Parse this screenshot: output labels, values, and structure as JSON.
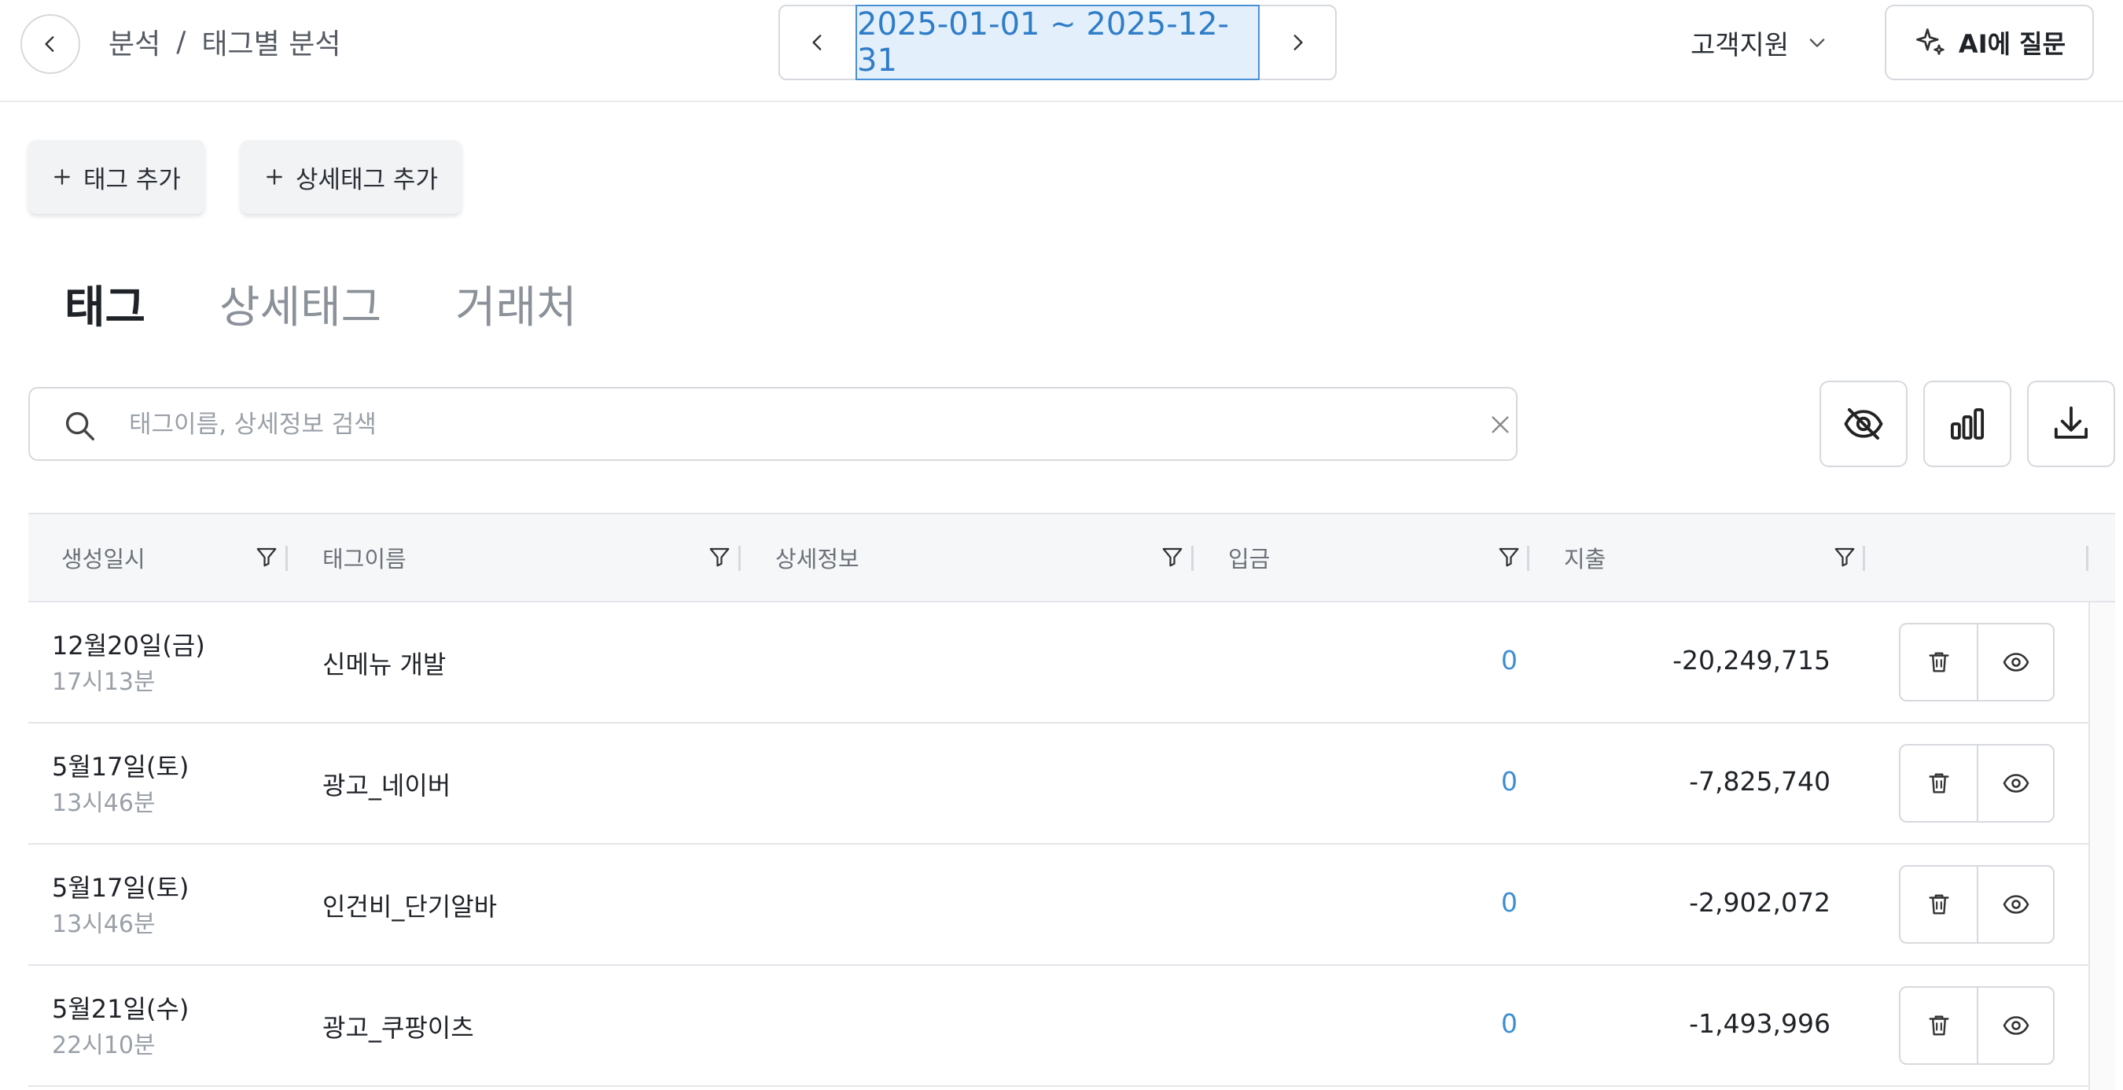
{
  "breadcrumb": {
    "parent": "분석",
    "separator": "/",
    "current": "태그별 분석"
  },
  "date_range": "2025-01-01 ~ 2025-12-31",
  "header": {
    "support_label": "고객지원",
    "ai_label": "AI에 질문"
  },
  "actions": {
    "add_tag": "태그 추가",
    "add_detail_tag": "상세태그 추가"
  },
  "tabs": [
    {
      "label": "태그",
      "active": true
    },
    {
      "label": "상세태그",
      "active": false
    },
    {
      "label": "거래처",
      "active": false
    }
  ],
  "search": {
    "placeholder": "태그이름, 상세정보 검색",
    "value": ""
  },
  "table": {
    "columns": [
      "생성일시",
      "태그이름",
      "상세정보",
      "입금",
      "지출"
    ],
    "rows": [
      {
        "date": "12월20일(금)",
        "time": "17시13분",
        "tag": "신메뉴 개발",
        "detail": "",
        "deposit": "0",
        "expense": "-20,249,715"
      },
      {
        "date": "5월17일(토)",
        "time": "13시46분",
        "tag": "광고_네이버",
        "detail": "",
        "deposit": "0",
        "expense": "-7,825,740"
      },
      {
        "date": "5월17일(토)",
        "time": "13시46분",
        "tag": "인건비_단기알바",
        "detail": "",
        "deposit": "0",
        "expense": "-2,902,072"
      },
      {
        "date": "5월21일(수)",
        "time": "22시10분",
        "tag": "광고_쿠팡이츠",
        "detail": "",
        "deposit": "0",
        "expense": "-1,493,996"
      }
    ]
  },
  "colors": {
    "accent": "#3b8ed4",
    "date_bg": "#e3f0fb",
    "muted": "#9aa0a8"
  },
  "icons": [
    "chevron-left-icon",
    "chevron-right-icon",
    "chevron-down-icon",
    "sparkle-icon",
    "plus-icon",
    "search-icon",
    "close-icon",
    "eye-off-icon",
    "bar-chart-icon",
    "download-icon",
    "filter-icon",
    "trash-icon",
    "eye-icon"
  ]
}
